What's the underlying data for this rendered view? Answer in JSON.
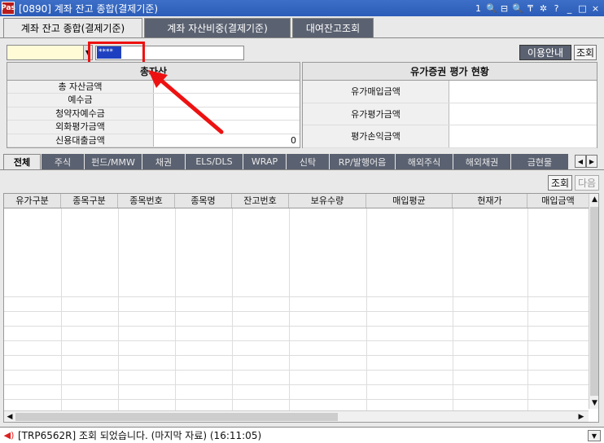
{
  "window": {
    "logo": "Pas",
    "title": "[0890] 계좌 잔고 종합(결제기준)",
    "controls": [
      "1",
      "🔍",
      "⊟",
      "🔍",
      "₸",
      "✲",
      "?",
      "_",
      "□",
      "×"
    ]
  },
  "tabs": [
    "계좌 잔고 종합(결제기준)",
    "계좌 자산비중(결제기준)",
    "대여잔고조회"
  ],
  "query": {
    "account_value": "****",
    "guide_button": "이용안내",
    "query_button": "조회"
  },
  "assets_panel": {
    "header": "총자산",
    "rows": [
      {
        "label": "총 자산금액",
        "value": ""
      },
      {
        "label": "예수금",
        "value": ""
      },
      {
        "label": "청약자예수금",
        "value": ""
      },
      {
        "label": "외화평가금액",
        "value": ""
      },
      {
        "label": "신용대출금액",
        "value": "0"
      }
    ]
  },
  "securities_panel": {
    "header": "유가증권 평가 현황",
    "rows": [
      {
        "label": "유가매입금액",
        "value": ""
      },
      {
        "label": "유가평가금액",
        "value": ""
      },
      {
        "label": "평가손익금액",
        "value": ""
      }
    ]
  },
  "category_tabs": [
    "전체",
    "주식",
    "펀드/MMW",
    "채권",
    "ELS/DLS",
    "WRAP",
    "신탁",
    "RP/발행어음",
    "해외주식",
    "해외채권",
    "금현물"
  ],
  "grid_buttons": {
    "query": "조회",
    "next": "다음"
  },
  "table": {
    "columns": [
      "유가구분",
      "종목구분",
      "종목번호",
      "종목명",
      "잔고번호",
      "보유수량",
      "매입평균",
      "현재가",
      "매입금액"
    ],
    "rows": []
  },
  "status": {
    "message": "[TRP6562R] 조회 되었습니다. (마지막 자료) (16:11:05)"
  },
  "colors": {
    "title_bar": "#2b5cb7",
    "tab_dark": "#5a6170",
    "highlight": "#ee1111",
    "account_field": "#fffbd6"
  }
}
